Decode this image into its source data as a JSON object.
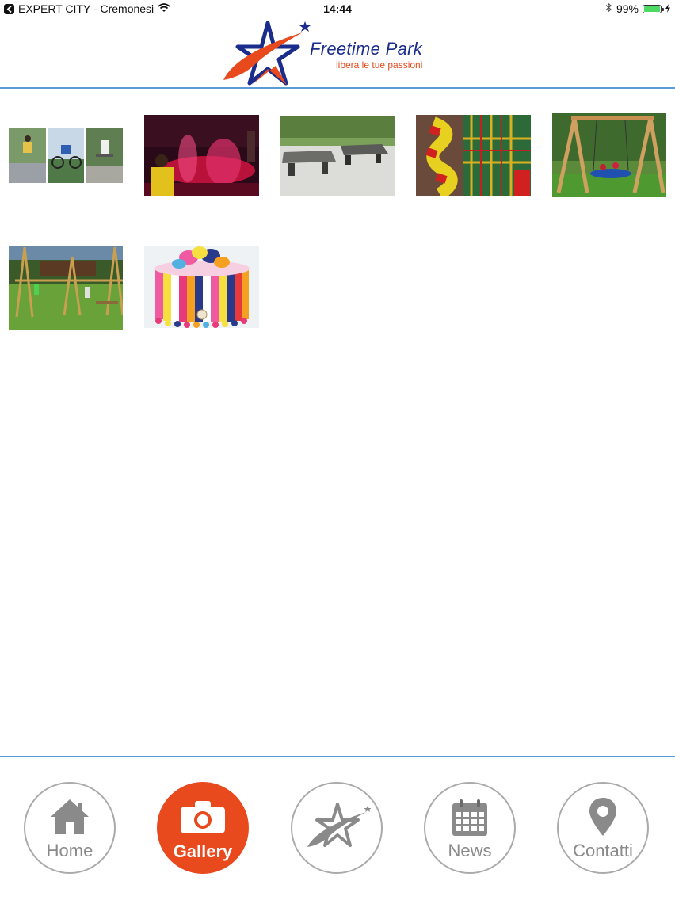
{
  "status_bar": {
    "carrier": "EXPERT CITY - Cremonesi",
    "time": "14:44",
    "battery": "99%",
    "battery_level": 0.99
  },
  "header": {
    "logo_title": "Freetime Park",
    "logo_subtitle": "libera le tue passioni"
  },
  "gallery": {
    "items": [
      {
        "icon": "bmx-skatepark-photo"
      },
      {
        "icon": "fountain-lights-photo"
      },
      {
        "icon": "ping-pong-tables-photo"
      },
      {
        "icon": "indoor-playground-photo"
      },
      {
        "icon": "nest-swing-photo"
      },
      {
        "icon": "wooden-playground-photo"
      },
      {
        "icon": "birthday-cake-photo"
      }
    ]
  },
  "tabbar": {
    "tabs": [
      {
        "label": "Home",
        "icon": "home-icon",
        "active": false
      },
      {
        "label": "Gallery",
        "icon": "camera-icon",
        "active": true
      },
      {
        "label": "",
        "icon": "star-logo-icon",
        "active": false
      },
      {
        "label": "News",
        "icon": "calendar-icon",
        "active": false
      },
      {
        "label": "Contatti",
        "icon": "location-pin-icon",
        "active": false
      }
    ]
  },
  "colors": {
    "accent": "#e8491d",
    "brand_blue": "#1a2c8c",
    "divider": "#5b9bd5",
    "tab_inactive": "#aaaaaa"
  }
}
